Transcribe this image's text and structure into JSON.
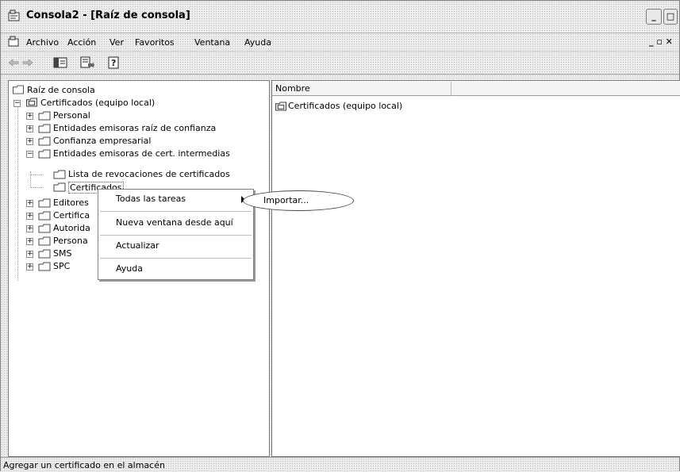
{
  "window": {
    "title": "Consola2 - [Raíz de consola]"
  },
  "menubar": {
    "items": [
      "Archivo",
      "Acción",
      "Ver",
      "Favoritos",
      "Ventana",
      "Ayuda"
    ],
    "mdi_controls": "_ ▫ ✕"
  },
  "toolbar": {
    "buttons": [
      "back-arrow-icon",
      "forward-arrow-icon",
      "show-hide-tree-icon",
      "export-list-icon",
      "help-icon"
    ]
  },
  "tree": {
    "root": "Raíz de consola",
    "certs_local": "Certificados (equipo local)",
    "personal": "Personal",
    "trusted_root": "Entidades emisoras raíz de confianza",
    "enterprise_trust": "Confianza empresarial",
    "intermediate": "Entidades emisoras de cert. intermedias",
    "crl": "Lista de revocaciones de certificados",
    "certificados": "Certificados",
    "editores": "Editores",
    "certifica": "Certifica",
    "autorida": "Autorida",
    "persona": "Persona",
    "sms": "SMS",
    "spc": "SPC"
  },
  "list": {
    "columns": [
      "Nombre",
      ""
    ],
    "items": [
      "Certificados (equipo local)"
    ]
  },
  "context_menu": {
    "all_tasks": "Todas las tareas",
    "new_window": "Nueva ventana desde aquí",
    "refresh": "Actualizar",
    "help": "Ayuda"
  },
  "submenu": {
    "import": "Importar..."
  },
  "status": {
    "text": "Agregar un certificado en el almacén"
  }
}
